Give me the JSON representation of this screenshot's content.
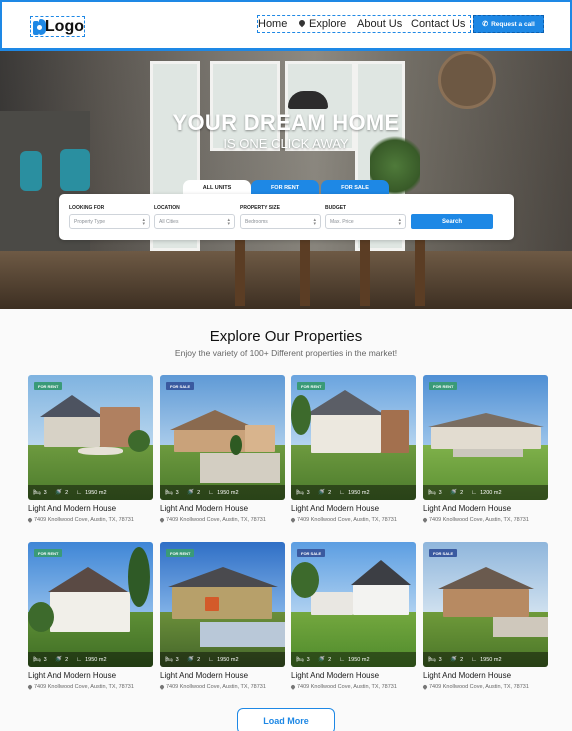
{
  "header": {
    "logo_text": "Logo",
    "nav": [
      {
        "label": "Home"
      },
      {
        "label": "Explore",
        "icon": "location-pin-icon"
      },
      {
        "label": "About Us"
      },
      {
        "label": "Contact Us"
      }
    ],
    "cta_label": "Request a call",
    "cta_icon": "phone-icon",
    "accent_color": "#1e88e5"
  },
  "hero": {
    "title": "YOUR DREAM HOME",
    "subtitle": "IS ONE CLICK AWAY",
    "tabs": [
      {
        "label": "ALL UNITS",
        "active": true
      },
      {
        "label": "FOR RENT",
        "active": false
      },
      {
        "label": "FOR SALE",
        "active": false
      }
    ],
    "search": {
      "fields": [
        {
          "label": "LOOKING FOR",
          "value": "Property Type"
        },
        {
          "label": "LOCATION",
          "value": "All Cities"
        },
        {
          "label": "PROPERTY SIZE",
          "value": "Bedrooms"
        },
        {
          "label": "BUDGET",
          "value": "Max. Price"
        }
      ],
      "button_label": "Search"
    }
  },
  "section": {
    "title": "Explore Our Properties",
    "subtitle": "Enjoy the variety of 100+ Different properties in the market!"
  },
  "properties": [
    {
      "badge": "FOR RENT",
      "beds": "3",
      "baths": "2",
      "area": "1950 m2",
      "title": "Light And Modern House",
      "address": "7409 Knollwood Cove, Austin, TX, 78731"
    },
    {
      "badge": "FOR SALE",
      "beds": "3",
      "baths": "2",
      "area": "1950 m2",
      "title": "Light And Modern House",
      "address": "7409 Knollwood Cove, Austin, TX, 78731"
    },
    {
      "badge": "FOR RENT",
      "beds": "3",
      "baths": "2",
      "area": "1950 m2",
      "title": "Light And Modern House",
      "address": "7409 Knollwood Cove, Austin, TX, 78731"
    },
    {
      "badge": "FOR RENT",
      "beds": "3",
      "baths": "2",
      "area": "1200 m2",
      "title": "Light And Modern House",
      "address": "7409 Knollwood Cove, Austin, TX, 78731"
    },
    {
      "badge": "FOR RENT",
      "beds": "3",
      "baths": "2",
      "area": "1950 m2",
      "title": "Light And Modern House",
      "address": "7409 Knollwood Cove, Austin, TX, 78731"
    },
    {
      "badge": "FOR RENT",
      "beds": "3",
      "baths": "2",
      "area": "1950 m2",
      "title": "Light And Modern House",
      "address": "7409 Knollwood Cove, Austin, TX, 78731"
    },
    {
      "badge": "FOR SALE",
      "beds": "3",
      "baths": "2",
      "area": "1950 m2",
      "title": "Light And Modern House",
      "address": "7409 Knollwood Cove, Austin, TX, 78731"
    },
    {
      "badge": "FOR SALE",
      "beds": "3",
      "baths": "2",
      "area": "1950 m2",
      "title": "Light And Modern House",
      "address": "7409 Knollwood Cove, Austin, TX, 78731"
    }
  ],
  "load_more_label": "Load More"
}
